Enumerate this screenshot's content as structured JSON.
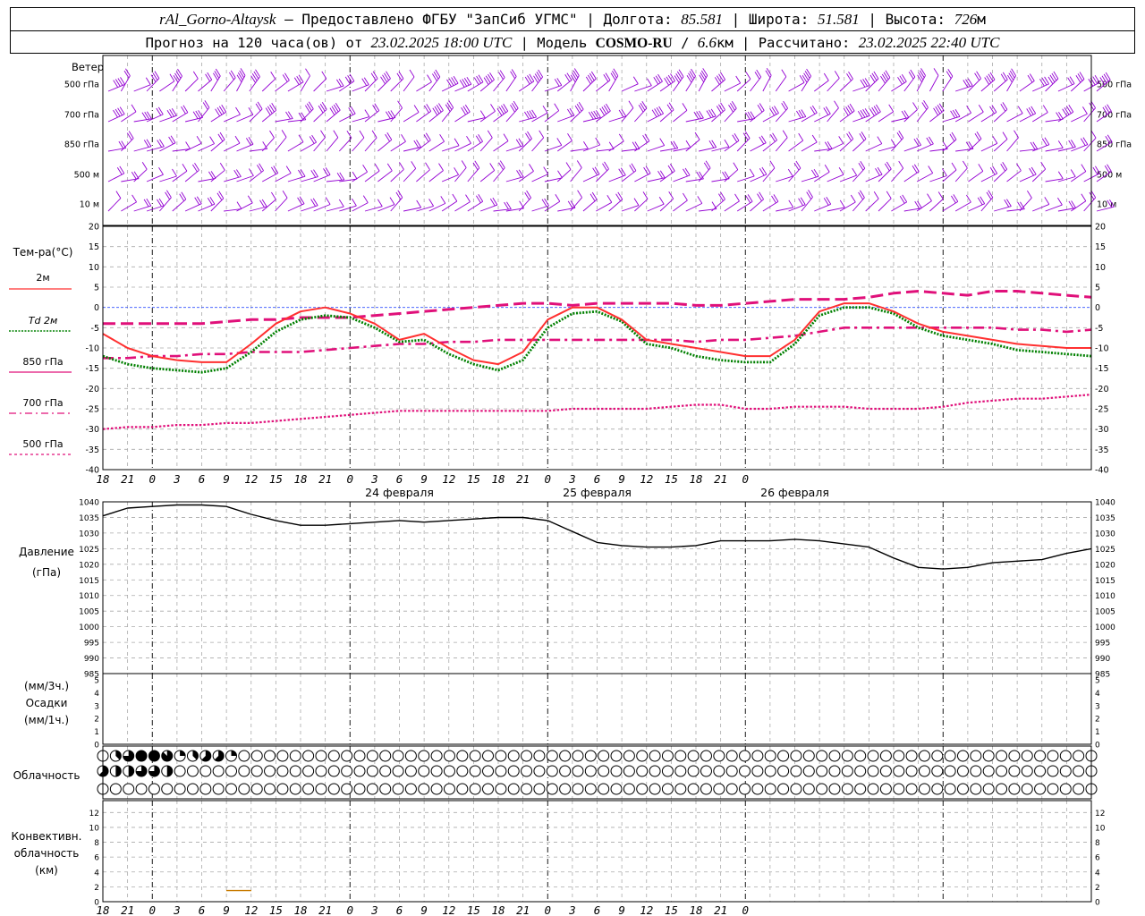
{
  "header": {
    "station": "rAl_Gorno-Altaysk",
    "provider": "Предоставлено ФГБУ \"ЗапСиб УГМС\"",
    "lon_label": "Долгота:",
    "lon_value": "85.581",
    "lat_label": "Широта:",
    "lat_value": "51.581",
    "alt_label": "Высота:",
    "alt_value": "726",
    "alt_unit": "м",
    "forecast_label": "Прогноз на 120 часа(ов) от",
    "forecast_start": "23.02.2025 18:00 UTC",
    "model_label": "Модель",
    "model_name": "COSMO-RU",
    "model_res": "6.6",
    "model_res_unit": "км",
    "computed_label": "Рассчитано:",
    "computed_time": "23.02.2025 22:40 UTC"
  },
  "panels": {
    "wind": {
      "title": "Ветер",
      "levels": [
        "500 гПа",
        "700 гПа",
        "850 гПа",
        "500  м",
        "10  м"
      ]
    },
    "temperature": {
      "title": "Тем-ра(°C)",
      "legend": [
        {
          "label": "2м",
          "color": "#ff3030",
          "style": "solid"
        },
        {
          "label": "Td  2м",
          "color": "#008000",
          "style": "dotted"
        },
        {
          "label": "850 гПа",
          "color": "#e0107a",
          "style": "solid-thin"
        },
        {
          "label": "700 гПа",
          "color": "#e0107a",
          "style": "dashdot"
        },
        {
          "label": "500 гПа",
          "color": "#e0107a",
          "style": "dashed"
        }
      ]
    },
    "pressure": {
      "title": "Давление",
      "unit": "(гПа)"
    },
    "precip": {
      "unit_3h": "(мм/3ч.)",
      "title": "Осадки",
      "unit_1h": "(мм/1ч.)"
    },
    "clouds": {
      "title": "Облачность"
    },
    "convective": {
      "title1": "Конвективн.",
      "title2": "облачность",
      "unit": "(км)"
    }
  },
  "time_axis": {
    "tick_labels": [
      "18",
      "21",
      "0",
      "3",
      "6",
      "9",
      "12",
      "15",
      "18",
      "21",
      "0",
      "3",
      "6",
      "9",
      "12",
      "15",
      "18",
      "21",
      "0",
      "3",
      "6",
      "9",
      "12",
      "15",
      "18",
      "21",
      "0"
    ],
    "day_labels": [
      "24 февраля",
      "25 февраля",
      "26 февраля"
    ]
  },
  "chart_data": [
    {
      "type": "line",
      "title": "Тем-ра(°C)",
      "x_unit": "hours from 23.02.2025 18:00 UTC",
      "ylim": [
        -40,
        20
      ],
      "yticks": [
        20,
        15,
        10,
        5,
        0,
        -5,
        -10,
        -15,
        -20,
        -25,
        -30,
        -35,
        -40
      ],
      "x": [
        0,
        3,
        6,
        9,
        12,
        15,
        18,
        21,
        24,
        27,
        30,
        33,
        36,
        39,
        42,
        45,
        48,
        51,
        54,
        57,
        60,
        63,
        66,
        69,
        72,
        75,
        78,
        81,
        84,
        87,
        90,
        93,
        96,
        99,
        102,
        105,
        108,
        111,
        114,
        117,
        120
      ],
      "series": [
        {
          "name": "2м",
          "color": "#ff3030",
          "values": [
            -6.5,
            -10,
            -12,
            -13,
            -13.5,
            -13.5,
            -9,
            -4,
            -1,
            0,
            -1.5,
            -4,
            -8,
            -6.5,
            -10,
            -13,
            -14,
            -11,
            -3,
            0,
            0,
            -3,
            -8,
            -9,
            -10,
            -11,
            -12,
            -12,
            -8,
            -1,
            1,
            1,
            -1,
            -4,
            -6,
            -7,
            -8,
            -9,
            -9.5,
            -10,
            -10
          ]
        },
        {
          "name": "Td  2м",
          "color": "#008000",
          "values": [
            -12,
            -14,
            -15,
            -15.5,
            -16,
            -15,
            -11,
            -6,
            -3,
            -2,
            -2.5,
            -5,
            -8.5,
            -8,
            -11.5,
            -14,
            -15.5,
            -13,
            -5,
            -1.5,
            -1,
            -3.5,
            -9,
            -10,
            -12,
            -13,
            -13.5,
            -13.5,
            -9,
            -2,
            0,
            0,
            -1.5,
            -5,
            -7,
            -8,
            -9,
            -10.5,
            -11,
            -11.5,
            -12
          ]
        },
        {
          "name": "850 гПа",
          "color": "#e0107a",
          "values": [
            -4,
            -4,
            -4,
            -4,
            -4,
            -3.5,
            -3,
            -3,
            -2.5,
            -2.5,
            -2.5,
            -2,
            -1.5,
            -1,
            -0.5,
            0,
            0.5,
            1,
            1,
            0.5,
            1,
            1,
            1,
            1,
            0.5,
            0.5,
            1,
            1.5,
            2,
            2,
            2,
            2.5,
            3.5,
            4,
            3.5,
            3,
            4,
            4,
            3.5,
            3,
            2.5
          ]
        },
        {
          "name": "700 гПа",
          "color": "#e0107a",
          "values": [
            -12.5,
            -12.5,
            -12,
            -12,
            -11.5,
            -11.5,
            -11,
            -11,
            -11,
            -10.5,
            -10,
            -9.5,
            -9,
            -9,
            -8.5,
            -8.5,
            -8,
            -8,
            -8,
            -8,
            -8,
            -8,
            -8,
            -8,
            -8.5,
            -8,
            -8,
            -7.5,
            -7,
            -6,
            -5,
            -5,
            -5,
            -5,
            -5,
            -5,
            -5,
            -5.5,
            -5.5,
            -6,
            -5.5
          ]
        },
        {
          "name": "500 гПа",
          "color": "#e0107a",
          "values": [
            -30,
            -29.5,
            -29.5,
            -29,
            -29,
            -28.5,
            -28.5,
            -28,
            -27.5,
            -27,
            -26.5,
            -26,
            -25.5,
            -25.5,
            -25.5,
            -25.5,
            -25.5,
            -25.5,
            -25.5,
            -25,
            -25,
            -25,
            -25,
            -24.5,
            -24,
            -24,
            -25,
            -25,
            -24.5,
            -24.5,
            -24.5,
            -25,
            -25,
            -25,
            -24.5,
            -23.5,
            -23,
            -22.5,
            -22.5,
            -22,
            -21.5
          ]
        }
      ]
    },
    {
      "type": "line",
      "title": "Давление",
      "x_unit": "hours from 23.02.2025 18:00 UTC",
      "ylim": [
        985,
        1040
      ],
      "yticks": [
        1040,
        1035,
        1030,
        1025,
        1020,
        1015,
        1010,
        1005,
        1000,
        995,
        990,
        985
      ],
      "x": [
        0,
        3,
        6,
        9,
        12,
        15,
        18,
        21,
        24,
        27,
        30,
        33,
        36,
        39,
        42,
        45,
        48,
        51,
        54,
        57,
        60,
        63,
        66,
        69,
        72,
        75,
        78,
        81,
        84,
        87,
        90,
        93,
        96,
        99,
        102,
        105,
        108,
        111,
        114,
        117,
        120
      ],
      "series": [
        {
          "name": "Давление",
          "color": "#000000",
          "values": [
            1035.5,
            1038,
            1038.5,
            1039,
            1039,
            1038.5,
            1036,
            1034,
            1032.5,
            1032.5,
            1033,
            1033.5,
            1034,
            1033.5,
            1034,
            1034.5,
            1035,
            1035,
            1034,
            1030.5,
            1027,
            1026,
            1025.5,
            1025.5,
            1026,
            1027.5,
            1027.5,
            1027.5,
            1028,
            1027.5,
            1026.5,
            1025.5,
            1022,
            1019,
            1018.5,
            1019,
            1020.5,
            1021,
            1021.5,
            1023.5,
            1025
          ]
        }
      ]
    },
    {
      "type": "bar",
      "title": "Осадки",
      "ylim": [
        0,
        5
      ],
      "yticks": [
        5,
        4,
        3,
        2,
        1,
        0
      ],
      "values": []
    },
    {
      "type": "table",
      "title": "Облачность",
      "note": "cloud cover in eighths per 3-hour step; three rows",
      "rows": [
        [
          0,
          3,
          6,
          8,
          8,
          7,
          2,
          3,
          5,
          5,
          2,
          0,
          0,
          0,
          0,
          0,
          0,
          0,
          0,
          0,
          0,
          0,
          0,
          0,
          0,
          0,
          0,
          0,
          0,
          0,
          0,
          0,
          0,
          0,
          0,
          0,
          0,
          0,
          0,
          0,
          0,
          0,
          0,
          0,
          0,
          0,
          0,
          0,
          0,
          0,
          0,
          0,
          0,
          0,
          0,
          0,
          0,
          0,
          0,
          0,
          0,
          0,
          0,
          0,
          0,
          0,
          0,
          0,
          0,
          0,
          0,
          0,
          0,
          0,
          0,
          0,
          0,
          0,
          0,
          0,
          0,
          0,
          0,
          0,
          0,
          0,
          0,
          0,
          0,
          0,
          0,
          0,
          0,
          0,
          0,
          0,
          0,
          0,
          0,
          0,
          0,
          0,
          0,
          0,
          0,
          0,
          0,
          0,
          0,
          0,
          0,
          0,
          0,
          0,
          0,
          0,
          0,
          0,
          0,
          0,
          0,
          0,
          0,
          0,
          0,
          0,
          0,
          0,
          0,
          0,
          0,
          0,
          0,
          0,
          0,
          0,
          0,
          0,
          0,
          0,
          0,
          0,
          0
        ],
        [
          5,
          4,
          4,
          6,
          6,
          4,
          0,
          0,
          0,
          0,
          0,
          0,
          0,
          0,
          0,
          0,
          0,
          0,
          0,
          0,
          0,
          0,
          0,
          0,
          0,
          0,
          0,
          0,
          0,
          0,
          0,
          0,
          0,
          0,
          0,
          0,
          0,
          0,
          0,
          0,
          0,
          0,
          0,
          0,
          0,
          0,
          0,
          0,
          0,
          0,
          0,
          0,
          0,
          0,
          0,
          0,
          0,
          0,
          0,
          0,
          0,
          0,
          0,
          0,
          0,
          0,
          0,
          0,
          0,
          0,
          0,
          0,
          0,
          0,
          0,
          0,
          0,
          0,
          0,
          0,
          0,
          0,
          0,
          0,
          0,
          0,
          0,
          0,
          0,
          0,
          0,
          0,
          0,
          0,
          0,
          0,
          0,
          0,
          0,
          0,
          0,
          0,
          0,
          0,
          0,
          0,
          0,
          0,
          0,
          0,
          0,
          0,
          0,
          0,
          0,
          0,
          0,
          0,
          0,
          0,
          0,
          0,
          0,
          0,
          0,
          0,
          0,
          0,
          0,
          0,
          0,
          0,
          0,
          0,
          0,
          0,
          0,
          0,
          0,
          0,
          0,
          0,
          0
        ],
        [
          0,
          0,
          0,
          0,
          0,
          0,
          0,
          0,
          0,
          0,
          0,
          0,
          0,
          0,
          0,
          0,
          0,
          0,
          0,
          0,
          0,
          0,
          0,
          0,
          0,
          0,
          0,
          0,
          0,
          0,
          0,
          0,
          0,
          0,
          0,
          0,
          0,
          0,
          0,
          0,
          0,
          0,
          0,
          0,
          0,
          0,
          0,
          0,
          0,
          0,
          0,
          0,
          0,
          0,
          0,
          0,
          0,
          0,
          0,
          0,
          0,
          0,
          0,
          0,
          0,
          0,
          0,
          0,
          0,
          0,
          0,
          0,
          0,
          0,
          0,
          0,
          0,
          0,
          0,
          0,
          0,
          0,
          0,
          0,
          0,
          0,
          0,
          0,
          0,
          0,
          0,
          0,
          0,
          0,
          0,
          0,
          0,
          0,
          0,
          0,
          0,
          0,
          0,
          0,
          0,
          0,
          0,
          0,
          0,
          0,
          0,
          0,
          0,
          0,
          0,
          0,
          0,
          0,
          0,
          0,
          0,
          0,
          0,
          0,
          0,
          0,
          0,
          0,
          0,
          0,
          0,
          0,
          0,
          0,
          0,
          0,
          0,
          0,
          0,
          0,
          0,
          0,
          0
        ]
      ]
    },
    {
      "type": "bar",
      "title": "Конвективн. облачность",
      "ylim": [
        0,
        13
      ],
      "yticks": [
        12,
        10,
        8,
        6,
        4,
        2,
        0
      ],
      "values": [
        {
          "x": 16.5,
          "value": 1.5
        }
      ]
    }
  ]
}
